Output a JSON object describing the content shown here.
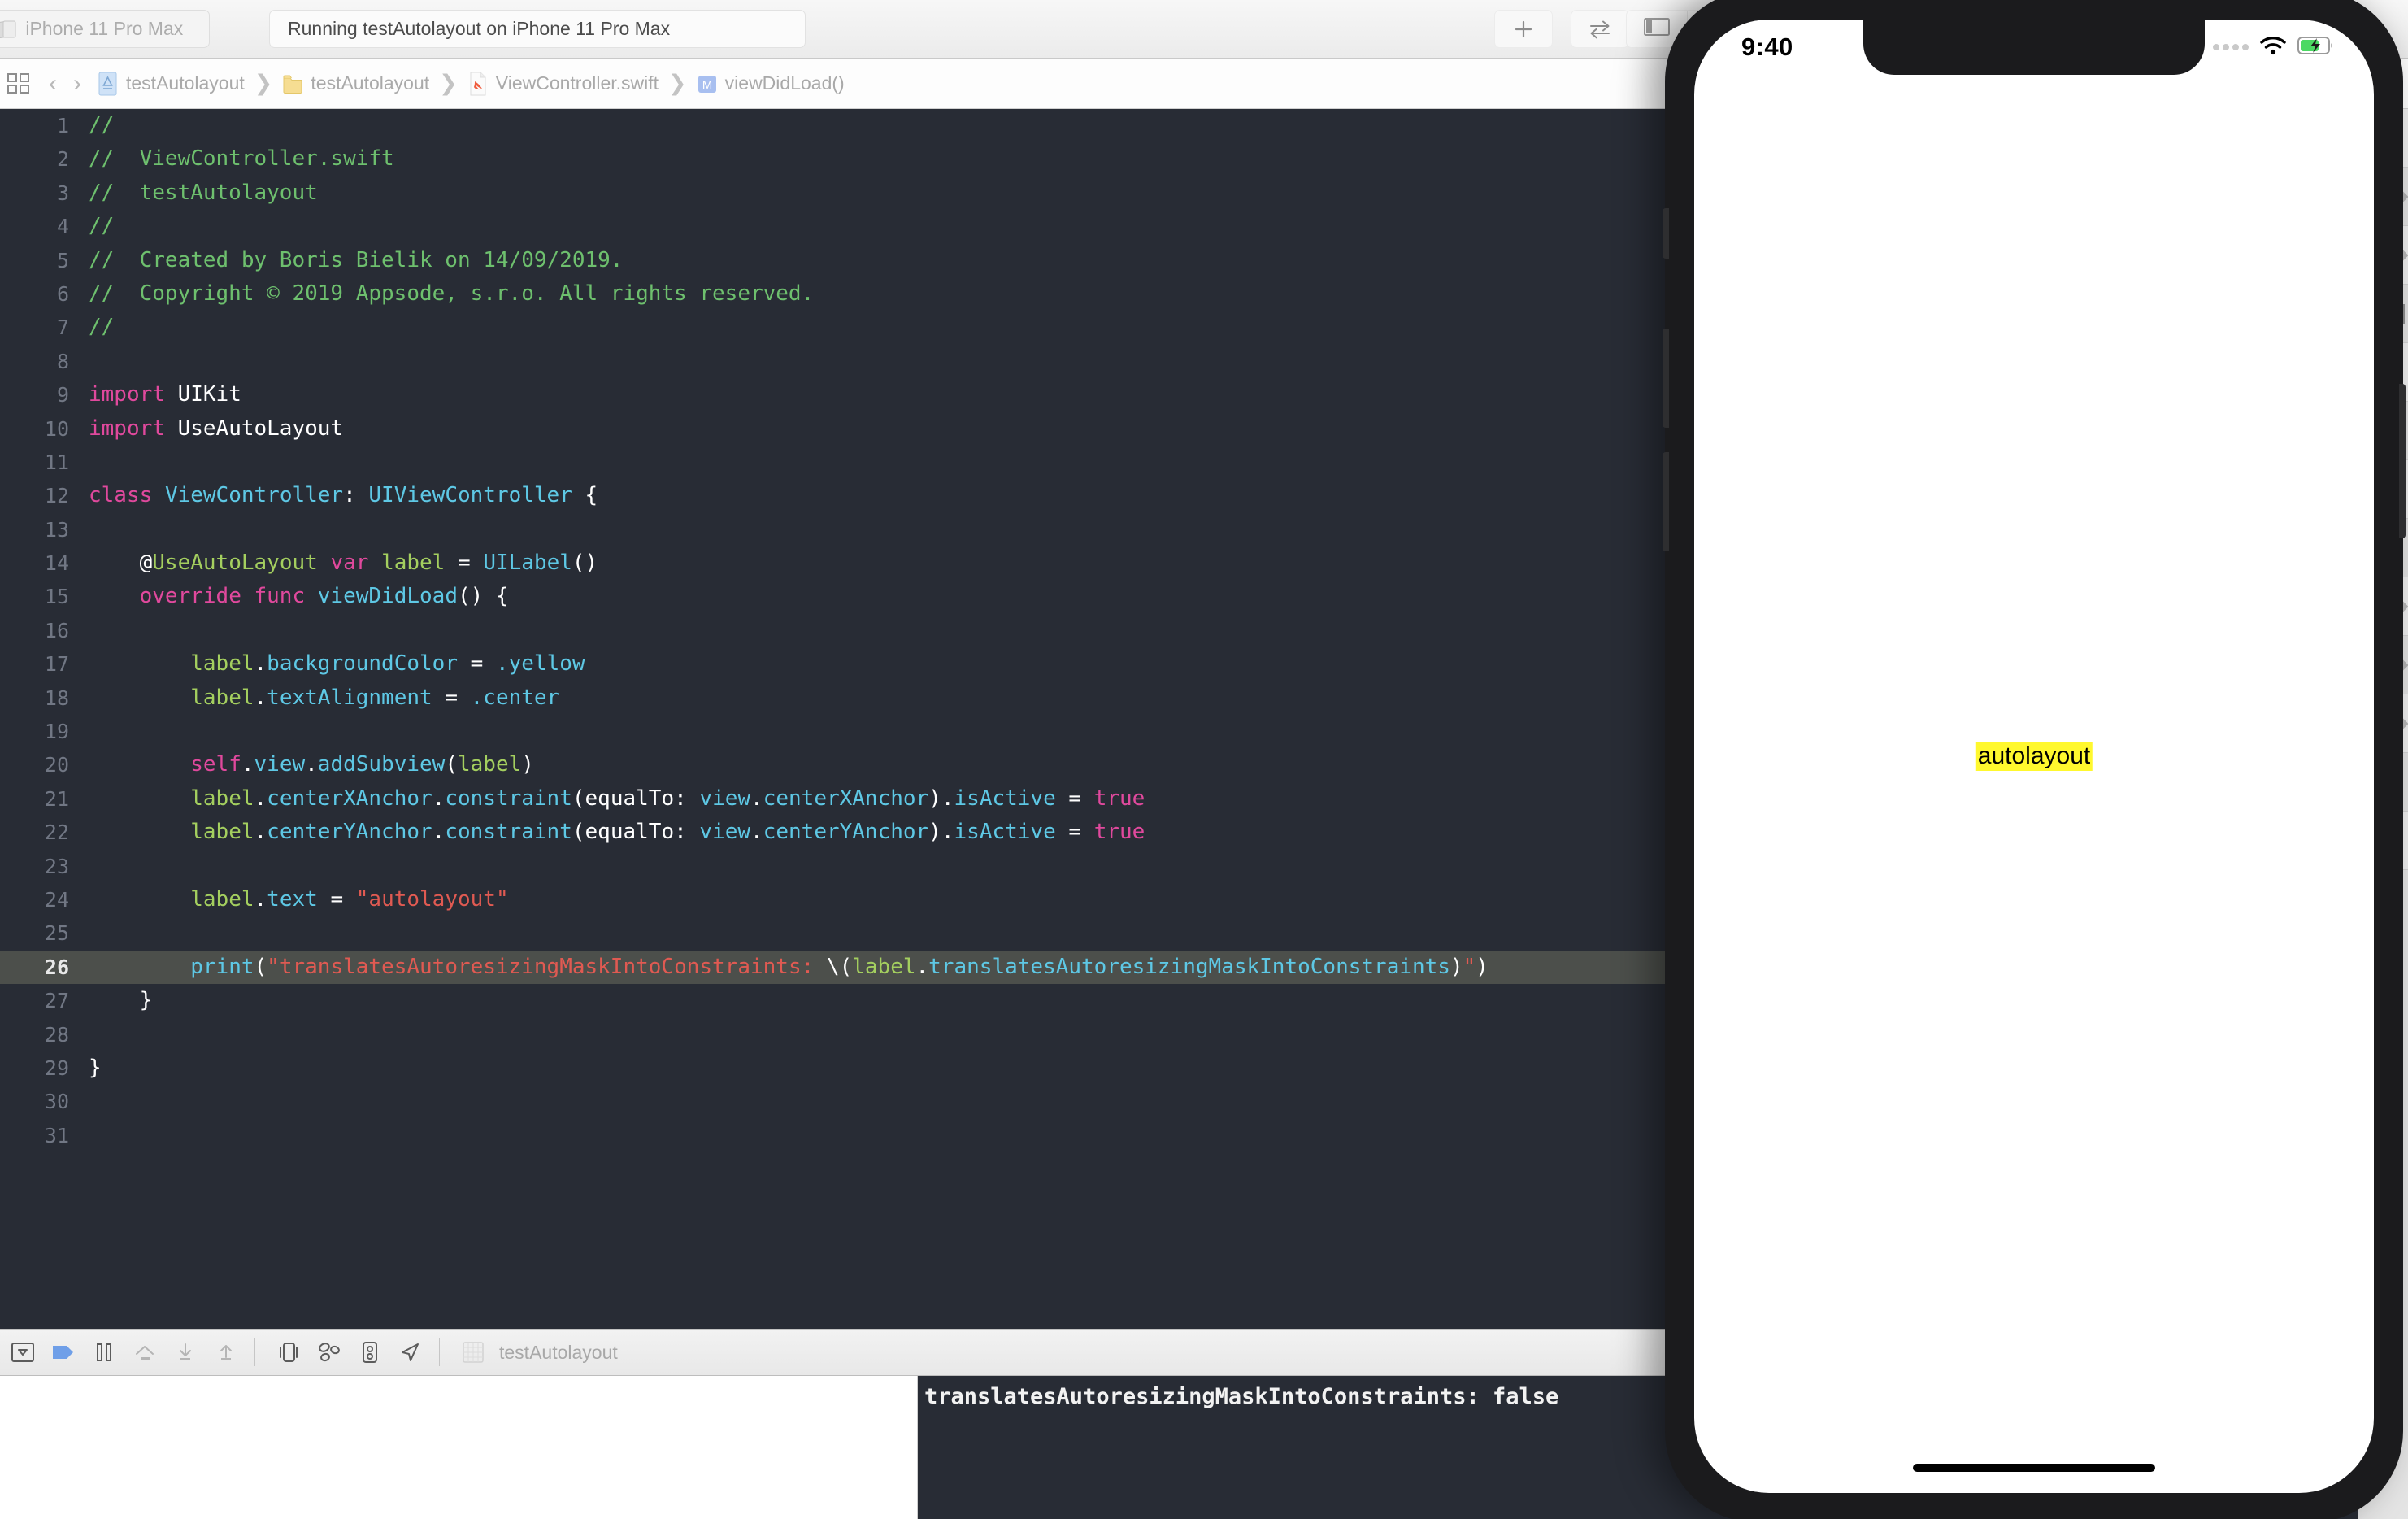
{
  "toolbar": {
    "scheme_chevron": "›",
    "scheme_label": "iPhone 11 Pro Max",
    "status_text": "Running testAutolayout on iPhone 11 Pro Max",
    "add_button_name": "add-editor-button",
    "swap_button_name": "swap-editor-button",
    "panel_left_name": "toggle-navigator-button",
    "panel_right_name": "toggle-inspector-button"
  },
  "jumpbar": {
    "back_arrow": "‹",
    "forward_arrow": "›",
    "separator": "❯",
    "crumbs": [
      {
        "label": "testAutolayout",
        "icon": "project-icon"
      },
      {
        "label": "testAutolayout",
        "icon": "folder-icon"
      },
      {
        "label": "ViewController.swift",
        "icon": "swift-file-icon"
      },
      {
        "label": "viewDidLoad()",
        "icon": "method-icon"
      }
    ]
  },
  "editor": {
    "highlighted_line": 26,
    "lines": [
      {
        "n": 1,
        "tokens": [
          {
            "t": "//",
            "c": "c-comment"
          }
        ]
      },
      {
        "n": 2,
        "tokens": [
          {
            "t": "//  ViewController.swift",
            "c": "c-comment"
          }
        ]
      },
      {
        "n": 3,
        "tokens": [
          {
            "t": "//  testAutolayout",
            "c": "c-comment"
          }
        ]
      },
      {
        "n": 4,
        "tokens": [
          {
            "t": "//",
            "c": "c-comment"
          }
        ]
      },
      {
        "n": 5,
        "tokens": [
          {
            "t": "//  Created by Boris Bielik on 14/09/2019.",
            "c": "c-comment"
          }
        ]
      },
      {
        "n": 6,
        "tokens": [
          {
            "t": "//  Copyright © 2019 Appsode, s.r.o. All rights reserved.",
            "c": "c-comment"
          }
        ]
      },
      {
        "n": 7,
        "tokens": [
          {
            "t": "//",
            "c": "c-comment"
          }
        ]
      },
      {
        "n": 8,
        "tokens": []
      },
      {
        "n": 9,
        "tokens": [
          {
            "t": "import",
            "c": "c-keyword"
          },
          {
            "t": " ",
            "c": "c-plain"
          },
          {
            "t": "UIKit",
            "c": "c-type"
          }
        ]
      },
      {
        "n": 10,
        "tokens": [
          {
            "t": "import",
            "c": "c-keyword"
          },
          {
            "t": " ",
            "c": "c-plain"
          },
          {
            "t": "UseAutoLayout",
            "c": "c-type"
          }
        ]
      },
      {
        "n": 11,
        "tokens": []
      },
      {
        "n": 12,
        "tokens": [
          {
            "t": "class",
            "c": "c-keyword"
          },
          {
            "t": " ",
            "c": "c-plain"
          },
          {
            "t": "ViewController",
            "c": "c-class"
          },
          {
            "t": ": ",
            "c": "c-plain"
          },
          {
            "t": "UIViewController",
            "c": "c-class"
          },
          {
            "t": " {",
            "c": "c-plain"
          }
        ]
      },
      {
        "n": 13,
        "tokens": []
      },
      {
        "n": 14,
        "tokens": [
          {
            "t": "    @",
            "c": "c-plain"
          },
          {
            "t": "UseAutoLayout",
            "c": "c-attr"
          },
          {
            "t": " ",
            "c": "c-plain"
          },
          {
            "t": "var",
            "c": "c-keyword"
          },
          {
            "t": " ",
            "c": "c-plain"
          },
          {
            "t": "label",
            "c": "c-ident"
          },
          {
            "t": " = ",
            "c": "c-plain"
          },
          {
            "t": "UILabel",
            "c": "c-class"
          },
          {
            "t": "()",
            "c": "c-plain"
          }
        ]
      },
      {
        "n": 15,
        "tokens": [
          {
            "t": "    ",
            "c": "c-plain"
          },
          {
            "t": "override func",
            "c": "c-keyword"
          },
          {
            "t": " ",
            "c": "c-plain"
          },
          {
            "t": "viewDidLoad",
            "c": "c-func"
          },
          {
            "t": "() {",
            "c": "c-plain"
          }
        ]
      },
      {
        "n": 16,
        "tokens": []
      },
      {
        "n": 17,
        "tokens": [
          {
            "t": "        ",
            "c": "c-plain"
          },
          {
            "t": "label",
            "c": "c-ident"
          },
          {
            "t": ".",
            "c": "c-plain"
          },
          {
            "t": "backgroundColor",
            "c": "c-member"
          },
          {
            "t": " = ",
            "c": "c-plain"
          },
          {
            "t": ".yellow",
            "c": "c-member"
          }
        ]
      },
      {
        "n": 18,
        "tokens": [
          {
            "t": "        ",
            "c": "c-plain"
          },
          {
            "t": "label",
            "c": "c-ident"
          },
          {
            "t": ".",
            "c": "c-plain"
          },
          {
            "t": "textAlignment",
            "c": "c-member"
          },
          {
            "t": " = ",
            "c": "c-plain"
          },
          {
            "t": ".center",
            "c": "c-member"
          }
        ]
      },
      {
        "n": 19,
        "tokens": []
      },
      {
        "n": 20,
        "tokens": [
          {
            "t": "        ",
            "c": "c-plain"
          },
          {
            "t": "self",
            "c": "c-keyword"
          },
          {
            "t": ".",
            "c": "c-plain"
          },
          {
            "t": "view",
            "c": "c-member"
          },
          {
            "t": ".",
            "c": "c-plain"
          },
          {
            "t": "addSubview",
            "c": "c-member"
          },
          {
            "t": "(",
            "c": "c-plain"
          },
          {
            "t": "label",
            "c": "c-ident"
          },
          {
            "t": ")",
            "c": "c-plain"
          }
        ]
      },
      {
        "n": 21,
        "tokens": [
          {
            "t": "        ",
            "c": "c-plain"
          },
          {
            "t": "label",
            "c": "c-ident"
          },
          {
            "t": ".",
            "c": "c-plain"
          },
          {
            "t": "centerXAnchor",
            "c": "c-member"
          },
          {
            "t": ".",
            "c": "c-plain"
          },
          {
            "t": "constraint",
            "c": "c-member"
          },
          {
            "t": "(",
            "c": "c-plain"
          },
          {
            "t": "equalTo",
            "c": "c-plain"
          },
          {
            "t": ": ",
            "c": "c-plain"
          },
          {
            "t": "view",
            "c": "c-member"
          },
          {
            "t": ".",
            "c": "c-plain"
          },
          {
            "t": "centerXAnchor",
            "c": "c-member"
          },
          {
            "t": ")",
            "c": "c-plain"
          },
          {
            "t": ".",
            "c": "c-plain"
          },
          {
            "t": "isActive",
            "c": "c-member"
          },
          {
            "t": " = ",
            "c": "c-plain"
          },
          {
            "t": "true",
            "c": "c-keyword"
          }
        ]
      },
      {
        "n": 22,
        "tokens": [
          {
            "t": "        ",
            "c": "c-plain"
          },
          {
            "t": "label",
            "c": "c-ident"
          },
          {
            "t": ".",
            "c": "c-plain"
          },
          {
            "t": "centerYAnchor",
            "c": "c-member"
          },
          {
            "t": ".",
            "c": "c-plain"
          },
          {
            "t": "constraint",
            "c": "c-member"
          },
          {
            "t": "(",
            "c": "c-plain"
          },
          {
            "t": "equalTo",
            "c": "c-plain"
          },
          {
            "t": ": ",
            "c": "c-plain"
          },
          {
            "t": "view",
            "c": "c-member"
          },
          {
            "t": ".",
            "c": "c-plain"
          },
          {
            "t": "centerYAnchor",
            "c": "c-member"
          },
          {
            "t": ")",
            "c": "c-plain"
          },
          {
            "t": ".",
            "c": "c-plain"
          },
          {
            "t": "isActive",
            "c": "c-member"
          },
          {
            "t": " = ",
            "c": "c-plain"
          },
          {
            "t": "true",
            "c": "c-keyword"
          }
        ]
      },
      {
        "n": 23,
        "tokens": []
      },
      {
        "n": 24,
        "tokens": [
          {
            "t": "        ",
            "c": "c-plain"
          },
          {
            "t": "label",
            "c": "c-ident"
          },
          {
            "t": ".",
            "c": "c-plain"
          },
          {
            "t": "text",
            "c": "c-member"
          },
          {
            "t": " = ",
            "c": "c-plain"
          },
          {
            "t": "\"autolayout\"",
            "c": "c-string"
          }
        ]
      },
      {
        "n": 25,
        "tokens": []
      },
      {
        "n": 26,
        "tokens": [
          {
            "t": "        ",
            "c": "c-plain"
          },
          {
            "t": "print",
            "c": "c-func"
          },
          {
            "t": "(",
            "c": "c-plain"
          },
          {
            "t": "\"translatesAutoresizingMaskIntoConstraints: ",
            "c": "c-string"
          },
          {
            "t": "\\(",
            "c": "c-plain"
          },
          {
            "t": "label",
            "c": "c-ident"
          },
          {
            "t": ".",
            "c": "c-plain"
          },
          {
            "t": "translatesAutoresizingMaskIntoConstraints",
            "c": "c-member"
          },
          {
            "t": ")",
            "c": "c-plain"
          },
          {
            "t": "\"",
            "c": "c-string"
          },
          {
            "t": ")",
            "c": "c-plain"
          }
        ]
      },
      {
        "n": 27,
        "tokens": [
          {
            "t": "    }",
            "c": "c-plain"
          }
        ]
      },
      {
        "n": 28,
        "tokens": []
      },
      {
        "n": 29,
        "tokens": [
          {
            "t": "}",
            "c": "c-plain"
          }
        ]
      },
      {
        "n": 30,
        "tokens": []
      },
      {
        "n": 31,
        "tokens": []
      }
    ]
  },
  "debugbar": {
    "buttons": [
      {
        "name": "hide-debug-area-button",
        "icon": "chevron-in-box-icon"
      },
      {
        "name": "continue-button",
        "icon": "play-pointer-icon"
      },
      {
        "name": "pause-button",
        "icon": "pause-icon"
      },
      {
        "name": "step-over-button",
        "icon": "step-over-icon"
      },
      {
        "name": "step-into-button",
        "icon": "step-into-icon"
      },
      {
        "name": "step-out-button",
        "icon": "step-out-icon"
      },
      {
        "name": "debug-view-hierarchy-button",
        "icon": "view-hierarchy-icon"
      },
      {
        "name": "debug-memory-graph-button",
        "icon": "memory-graph-icon"
      },
      {
        "name": "environment-overrides-button",
        "icon": "environment-overrides-icon"
      },
      {
        "name": "simulate-location-button",
        "icon": "location-arrow-icon"
      }
    ],
    "process_label": "testAutolayout"
  },
  "console": {
    "output": "translatesAutoresizingMaskIntoConstraints: false"
  },
  "simulator": {
    "status_time": "9:40",
    "wifi_icon": "wifi-icon",
    "battery_icon": "battery-charging-icon",
    "label_text": "autolayout",
    "label_background": "#fff82e",
    "device": "iPhone 11 Pro Max"
  },
  "colors": {
    "editor_background": "#282c35",
    "highlight_line": "#4c4f4b",
    "comment_green": "#6ec06e",
    "keyword_pink": "#e0499d",
    "class_blue": "#5ec8e5",
    "string_red": "#e05a52",
    "ident_green": "#a4cf5f",
    "toolbar_grey": "#ebebeb"
  }
}
